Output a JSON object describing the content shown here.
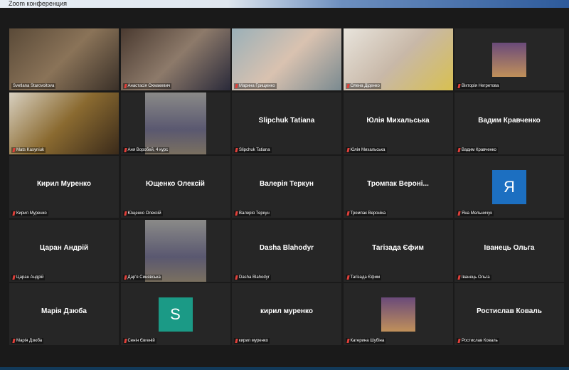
{
  "window": {
    "title": "Zoom конференция"
  },
  "colors": {
    "active": "#c9d46a",
    "mic_muted": "#e0403a",
    "avatar_ya": "#1c6fc1",
    "avatar_s": "#1b9a86"
  },
  "participants": [
    {
      "label": "Svetlana Starovoitova",
      "type": "video",
      "active": true
    },
    {
      "label": "Анастасія Охмакевич",
      "type": "video"
    },
    {
      "label": "Марина Грищенко",
      "type": "video"
    },
    {
      "label": "Олена Діденко",
      "type": "video"
    },
    {
      "label": "Вікторія Негретова",
      "type": "photo-small"
    },
    {
      "label": "Mats Kasyniuk",
      "type": "video"
    },
    {
      "label": "Аня Воробей, 4 курс",
      "type": "photo"
    },
    {
      "label": "Slipchuk Tatiana",
      "big": "Slipchuk Tatiana"
    },
    {
      "label": "Юлія Михальська",
      "big": "Юлія Михальська"
    },
    {
      "label": "Вадим Кравченко",
      "big": "Вадим Кравченко"
    },
    {
      "label": "Кирил Муренко",
      "big": "Кирил Муренко"
    },
    {
      "label": "Ющенко Олексій",
      "big": "Ющенко Олексій"
    },
    {
      "label": "Валерія Теркун",
      "big": "Валерія Теркун"
    },
    {
      "label": "Тромпак Вероніка",
      "big": "Тромпак  Вероні..."
    },
    {
      "label": "Яна Мельничук",
      "avatar": "Я"
    },
    {
      "label": "Царан Андрій",
      "big": "Царан Андрій"
    },
    {
      "label": "Дар'я Синявська",
      "type": "photo"
    },
    {
      "label": "Dasha Blahodyr",
      "big": "Dasha Blahodyr"
    },
    {
      "label": "Тагізада Єфим",
      "big": "Тагізада Єфим"
    },
    {
      "label": "Іванець Ольга",
      "big": "Іванець Ольга"
    },
    {
      "label": "Марія Дзюба",
      "big": "Марія Дзюба"
    },
    {
      "label": "Сенін Євгеній",
      "avatar": "S"
    },
    {
      "label": "кирил муренко",
      "big": "кирил муренко"
    },
    {
      "label": "Катерина Шубіна",
      "type": "photo-small"
    },
    {
      "label": "Ростислав Коваль",
      "big": "Ростислав Коваль"
    }
  ]
}
